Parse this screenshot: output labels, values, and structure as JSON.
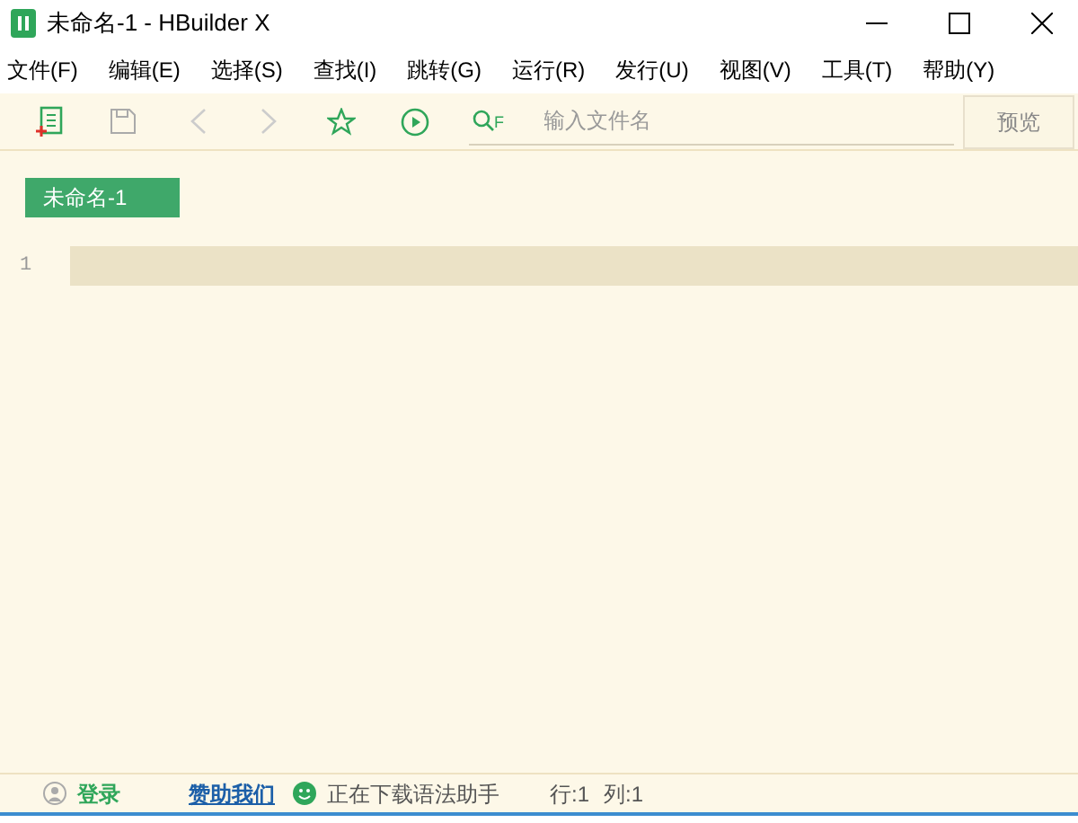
{
  "window": {
    "title": "未命名-1 - HBuilder X"
  },
  "menu": [
    "文件(F)",
    "编辑(E)",
    "选择(S)",
    "查找(I)",
    "跳转(G)",
    "运行(R)",
    "发行(U)",
    "视图(V)",
    "工具(T)",
    "帮助(Y)"
  ],
  "toolbar": {
    "search": {
      "hint": "F",
      "placeholder": "输入文件名"
    },
    "preview_button": "预览"
  },
  "tabs": [
    {
      "label": "未命名-1",
      "selected": true
    }
  ],
  "editor": {
    "lines": [
      {
        "number": "1",
        "current": true
      }
    ]
  },
  "status_bar": {
    "login": "登录",
    "sponsor": "赞助我们",
    "message": "正在下载语法助手",
    "row": "行:1",
    "column": "列:1"
  }
}
